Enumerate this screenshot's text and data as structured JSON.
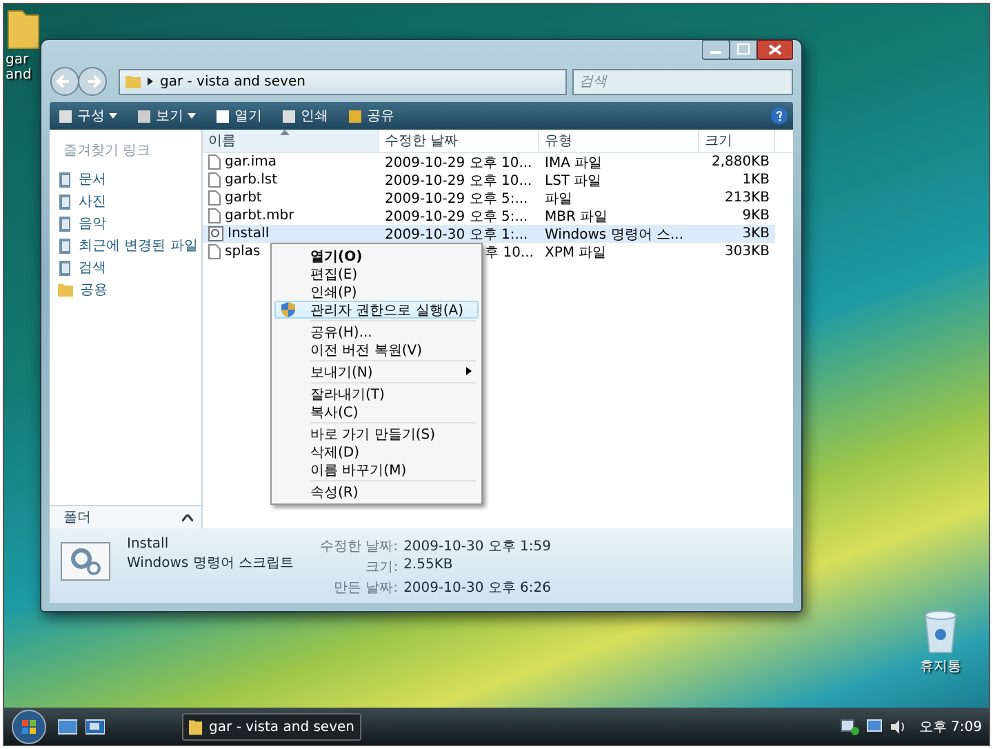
{
  "desktop_icons": [
    {
      "label": "gar and",
      "kind": "folder"
    },
    {
      "label": "휴지통",
      "kind": "bin"
    }
  ],
  "window": {
    "address": {
      "path": "gar - vista and seven"
    },
    "search": {
      "placeholder": "검색"
    },
    "toolbar": [
      {
        "label": "구성",
        "kind": "menu"
      },
      {
        "label": "보기",
        "kind": "menu"
      },
      {
        "label": "열기",
        "kind": "button"
      },
      {
        "label": "인쇄",
        "kind": "button"
      },
      {
        "label": "공유",
        "kind": "button"
      }
    ],
    "favorites": {
      "title": "즐겨찾기 링크",
      "items": [
        {
          "label": "문서"
        },
        {
          "label": "사진"
        },
        {
          "label": "음악"
        },
        {
          "label": "최근에 변경된 파일"
        },
        {
          "label": "검색"
        },
        {
          "label": "공용",
          "kind": "folder"
        }
      ]
    },
    "folders_bar": {
      "label": "폴더",
      "expanded": false
    },
    "table": {
      "columns": [
        {
          "label": "이름",
          "sorted": true
        },
        {
          "label": "수정한 날짜",
          "sorted": false
        },
        {
          "label": "유형",
          "sorted": false
        },
        {
          "label": "크기",
          "sorted": false
        }
      ],
      "rows": [
        {
          "name": "gar.ima",
          "modified": "2009-10-29 오후 10...",
          "partial": false,
          "type": "IMA 파일",
          "size": "2,880KB",
          "selected": false,
          "kind": "file"
        },
        {
          "name": "garb.lst",
          "modified": "2009-10-29 오후 10...",
          "partial": false,
          "type": "LST 파일",
          "size": "1KB",
          "selected": false,
          "kind": "file"
        },
        {
          "name": "garbt",
          "modified": "2009-10-29 오후 5:...",
          "partial": false,
          "type": "파일",
          "size": "213KB",
          "selected": false,
          "kind": "file"
        },
        {
          "name": "garbt.mbr",
          "modified": "2009-10-29 오후 5:...",
          "partial": false,
          "type": "MBR 파일",
          "size": "9KB",
          "selected": false,
          "kind": "file"
        },
        {
          "name": "Install",
          "modified": "2009-10-30 오후 1:...",
          "partial": false,
          "type": "Windows 명령어 스...",
          "size": "3KB",
          "selected": true,
          "kind": "script"
        },
        {
          "name": "splas",
          "modified": "후 10...",
          "partial": true,
          "type": "XPM 파일",
          "size": "303KB",
          "selected": false,
          "kind": "file"
        }
      ]
    },
    "details": {
      "name": "Install",
      "type": "Windows 명령어 스크립트",
      "fields": [
        {
          "label": "수정한 날짜:",
          "value": "2009-10-30 오후 1:59"
        },
        {
          "label": "크기:",
          "value": "2.55KB"
        },
        {
          "label": "만든 날짜:",
          "value": "2009-10-30 오후 6:26"
        }
      ]
    }
  },
  "context_menu": {
    "groups": [
      [
        {
          "label": "열기(O)",
          "kind": "default",
          "selected": false
        },
        {
          "label": "편집(E)",
          "kind": "item",
          "selected": false
        },
        {
          "label": "인쇄(P)",
          "kind": "item",
          "selected": false
        },
        {
          "label": "관리자 권한으로 실행(A)",
          "kind": "admin",
          "selected": true
        }
      ],
      [
        {
          "label": "공유(H)...",
          "kind": "item",
          "selected": false
        },
        {
          "label": "이전 버전 복원(V)",
          "kind": "item",
          "selected": false
        }
      ],
      [
        {
          "label": "보내기(N)",
          "kind": "submenu",
          "selected": false
        }
      ],
      [
        {
          "label": "잘라내기(T)",
          "kind": "item",
          "selected": false
        },
        {
          "label": "복사(C)",
          "kind": "item",
          "selected": false
        }
      ],
      [
        {
          "label": "바로 가기 만들기(S)",
          "kind": "item",
          "selected": false
        },
        {
          "label": "삭제(D)",
          "kind": "item",
          "selected": false
        },
        {
          "label": "이름 바꾸기(M)",
          "kind": "item",
          "selected": false
        }
      ],
      [
        {
          "label": "속성(R)",
          "kind": "item",
          "selected": false
        }
      ]
    ]
  },
  "taskbar": {
    "windows": [
      {
        "label": "gar - vista and seven",
        "selected": true
      }
    ],
    "clock": "오후 7:09"
  }
}
